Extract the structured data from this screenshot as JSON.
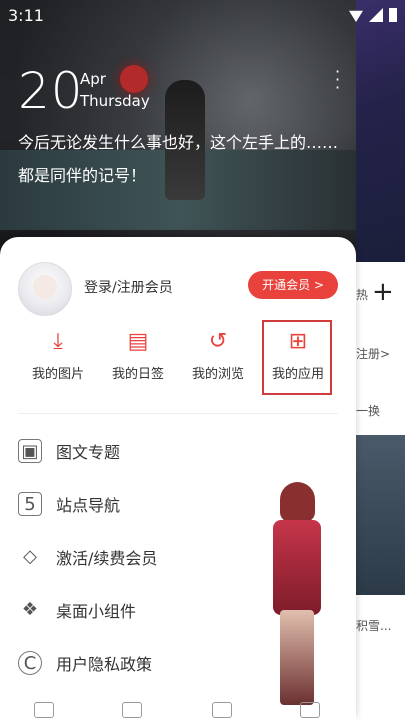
{
  "status": {
    "time": "3:11"
  },
  "hero": {
    "day": "20",
    "month": "Apr",
    "weekday": "Thursday",
    "quote": "今后无论发生什么事也好，这个左手上的……都是同伴的记号！"
  },
  "sheet": {
    "login_text": "登录/注册会员",
    "vip_button": "开通会员 >",
    "quick_items": [
      {
        "label": "我的图片",
        "icon": "download-icon"
      },
      {
        "label": "我的日签",
        "icon": "calendar-icon"
      },
      {
        "label": "我的浏览",
        "icon": "history-icon"
      },
      {
        "label": "我的应用",
        "icon": "apps-grid-icon"
      }
    ],
    "menu_items": [
      {
        "label": "图文专题",
        "icon": "image-topic-icon"
      },
      {
        "label": "站点导航",
        "icon": "html5-icon"
      },
      {
        "label": "激活/续费会员",
        "icon": "diamond-icon"
      },
      {
        "label": "桌面小组件",
        "icon": "widget-icon"
      },
      {
        "label": "用户隐私政策",
        "icon": "copyright-icon"
      }
    ]
  },
  "right_strip": {
    "label1": "热",
    "label2": "注册>",
    "label3": "一换",
    "label4": "积雪..."
  },
  "colors": {
    "accent": "#e9423c"
  }
}
